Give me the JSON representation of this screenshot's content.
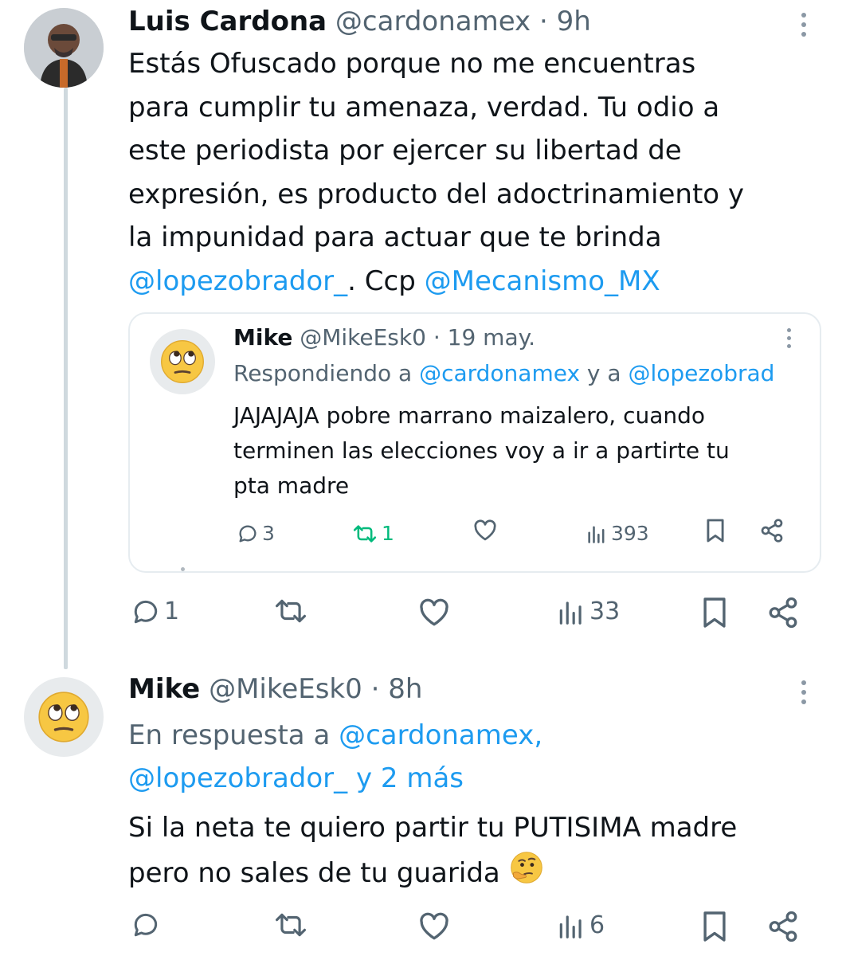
{
  "tweet1": {
    "name": "Luis Cardona",
    "handle": "@cardonamex",
    "sep": " · ",
    "time": "9h",
    "lines": [
      "Estás Ofuscado porque no me encuentras",
      "para cumplir tu amenaza, verdad. Tu odio a",
      "este periodista por ejercer su libertad de",
      "expresión, es producto del adoctrinamiento y",
      "la impunidad para actuar que te brinda"
    ],
    "mention1": "@lopezobrador_",
    "mid_text": ". Ccp ",
    "mention2": "@Mecanismo_MX",
    "actions": {
      "replies": "1",
      "views": "33"
    }
  },
  "quote": {
    "name": "Mike",
    "handle": "@MikeEsk0",
    "sep": " · ",
    "time": "19 may.",
    "reply_prefix": "Respondiendo a ",
    "reply_mention1": "@cardonamex",
    "reply_and": " y a ",
    "reply_mention2": "@lopezobrad",
    "lines": [
      "JAJAJAJA pobre marrano maizalero, cuando",
      "terminen las elecciones voy a ir a partirte tu",
      "pta madre"
    ],
    "actions": {
      "replies": "3",
      "reposts": "1",
      "views": "393"
    }
  },
  "tweet2": {
    "name": "Mike",
    "handle": "@MikeEsk0",
    "sep": " · ",
    "time": "8h",
    "reply_prefix": "En respuesta a ",
    "reply_mention1": "@cardonamex",
    "reply_comma": ",",
    "reply_mention2": "@lopezobrador_ y 2 más",
    "lines": [
      "Si la neta te quiero partir tu PUTISIMA madre",
      "pero no sales de tu guarida"
    ],
    "emoji": "🤔",
    "actions": {
      "views": "6"
    }
  },
  "icons": {
    "reply": "reply-icon",
    "repost": "repost-icon",
    "like": "like-icon",
    "views": "views-icon",
    "bookmark": "bookmark-icon",
    "share": "share-icon",
    "more": "more-icon"
  },
  "colors": {
    "text": "#0f1419",
    "secondary": "#536471",
    "link": "#1d9bf0",
    "repost_active": "#00ba7c",
    "thread_line": "#cfd9de"
  }
}
